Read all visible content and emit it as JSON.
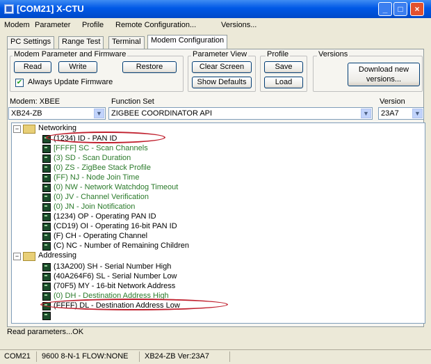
{
  "window": {
    "title": "[COM21] X-CTU"
  },
  "menu": [
    "Modem",
    "Parameter",
    "Profile",
    "Remote Configuration...",
    "Versions..."
  ],
  "tabs": [
    "PC Settings",
    "Range Test",
    "Terminal",
    "Modem Configuration"
  ],
  "active_tab": "Modem Configuration",
  "firmware_group": {
    "title": "Modem Parameter and Firmware",
    "read": "Read",
    "write": "Write",
    "restore": "Restore",
    "always_update": "Always Update Firmware",
    "always_update_checked": true
  },
  "param_view": {
    "title": "Parameter View",
    "clear": "Clear Screen",
    "show_defaults": "Show Defaults"
  },
  "profile": {
    "title": "Profile",
    "save": "Save",
    "load": "Load"
  },
  "versions_group": {
    "title": "Versions",
    "download_line1": "Download new",
    "download_line2": "versions..."
  },
  "modem_label": "Modem: XBEE",
  "modem_value": "XB24-ZB",
  "function_set_label": "Function Set",
  "function_set_value": "ZIGBEE COORDINATOR API",
  "version_label": "Version",
  "version_value": "23A7",
  "tree": {
    "networking": {
      "label": "Networking",
      "items": [
        {
          "text": "(1234) ID - PAN ID",
          "style": "normal"
        },
        {
          "text": "[FFFF] SC - Scan Channels",
          "style": "green"
        },
        {
          "text": "(3) SD - Scan Duration",
          "style": "green"
        },
        {
          "text": "(0) ZS - ZigBee Stack Profile",
          "style": "green"
        },
        {
          "text": "(FF) NJ - Node Join Time",
          "style": "green"
        },
        {
          "text": "(0) NW - Network Watchdog Timeout",
          "style": "green"
        },
        {
          "text": "(0) JV - Channel Verification",
          "style": "green"
        },
        {
          "text": "(0) JN - Join Notification",
          "style": "green"
        },
        {
          "text": "(1234) OP - Operating PAN ID",
          "style": "normal"
        },
        {
          "text": "(CD19) OI - Operating 16-bit PAN ID",
          "style": "normal"
        },
        {
          "text": "(F) CH - Operating Channel",
          "style": "normal"
        },
        {
          "text": "(C) NC - Number of Remaining Children",
          "style": "normal"
        }
      ]
    },
    "addressing": {
      "label": "Addressing",
      "items": [
        {
          "text": "(13A200) SH - Serial Number High",
          "style": "normal"
        },
        {
          "text": "(40A264F6) SL - Serial Number Low",
          "style": "normal"
        },
        {
          "text": "(70F5) MY - 16-bit Network Address",
          "style": "normal"
        },
        {
          "text": "(0) DH - Destination Address High",
          "style": "green"
        },
        {
          "text": "(FFFF) DL - Destination Address Low",
          "style": "normal"
        }
      ]
    }
  },
  "status_text": "Read parameters...OK",
  "statusbar": [
    "COM21",
    "9600 8-N-1  FLOW:NONE",
    "XB24-ZB  Ver:23A7"
  ],
  "colors": {
    "highlight": "#c0202e",
    "title_blue": "#0058e6",
    "green_text": "#2a7a2a"
  }
}
